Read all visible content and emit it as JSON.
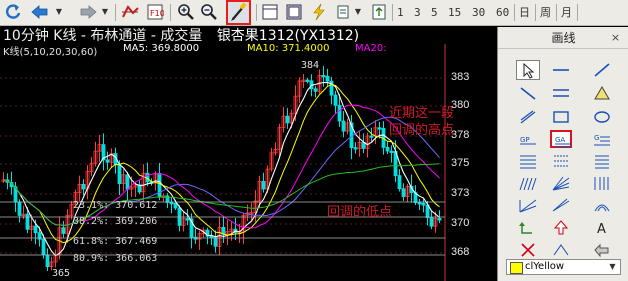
{
  "toolbar": {
    "periods": [
      "1",
      "3",
      "5",
      "15",
      "30",
      "60",
      "日",
      "周",
      "月"
    ]
  },
  "chart": {
    "title": "10分钟 K线 - 布林通道 - 成交量",
    "product": "银杏果1312(YX1312)",
    "ma_row": {
      "label": "K线(5,10,20,30,60)",
      "ma5": "MA5: 369.8000",
      "ma10": "MA10: 371.4000",
      "ma20": "MA20:"
    },
    "price_axis": [
      "383",
      "380",
      "378",
      "375",
      "373",
      "370",
      "368"
    ],
    "high_label": "384",
    "low_label": "365",
    "fib_levels": [
      {
        "pct": "23.1%",
        "price": "370.612"
      },
      {
        "pct": "38.2%",
        "price": "369.206"
      },
      {
        "pct": "61.8%",
        "price": "367.469"
      },
      {
        "pct": "80.9%",
        "price": "366.063"
      }
    ],
    "annotation_high": [
      "近期这一段",
      "回调的高点"
    ],
    "annotation_low": "回调的低点",
    "colors": {
      "up": "#ff3c3c",
      "down": "#00e0e0",
      "ma5": "#ffffff",
      "ma10": "#ffff00",
      "ma20": "#ff00ff",
      "annotation": "#d01a2a"
    }
  },
  "drawing_panel": {
    "title": "画线",
    "close_glyph": "×",
    "selected_color": "clYellow",
    "tools": [
      "pointer",
      "horizontal-line",
      "diagonal-line",
      "ray-line",
      "parallel-lines",
      "triangle",
      "rectangle",
      "ellipse",
      "arc",
      "gann-line",
      "golden-ratio",
      "gold-section",
      "channel-lines",
      "speed-lines",
      "percent-lines",
      "fan-lines",
      "gann-fan",
      "time-zone",
      "cycle-lines",
      "wave-lines",
      "fib-arcs",
      "up-arrow-mark",
      "down-arrow-mark",
      "text-note",
      "delete-tool",
      "hide-tool",
      "undo-tool"
    ]
  }
}
